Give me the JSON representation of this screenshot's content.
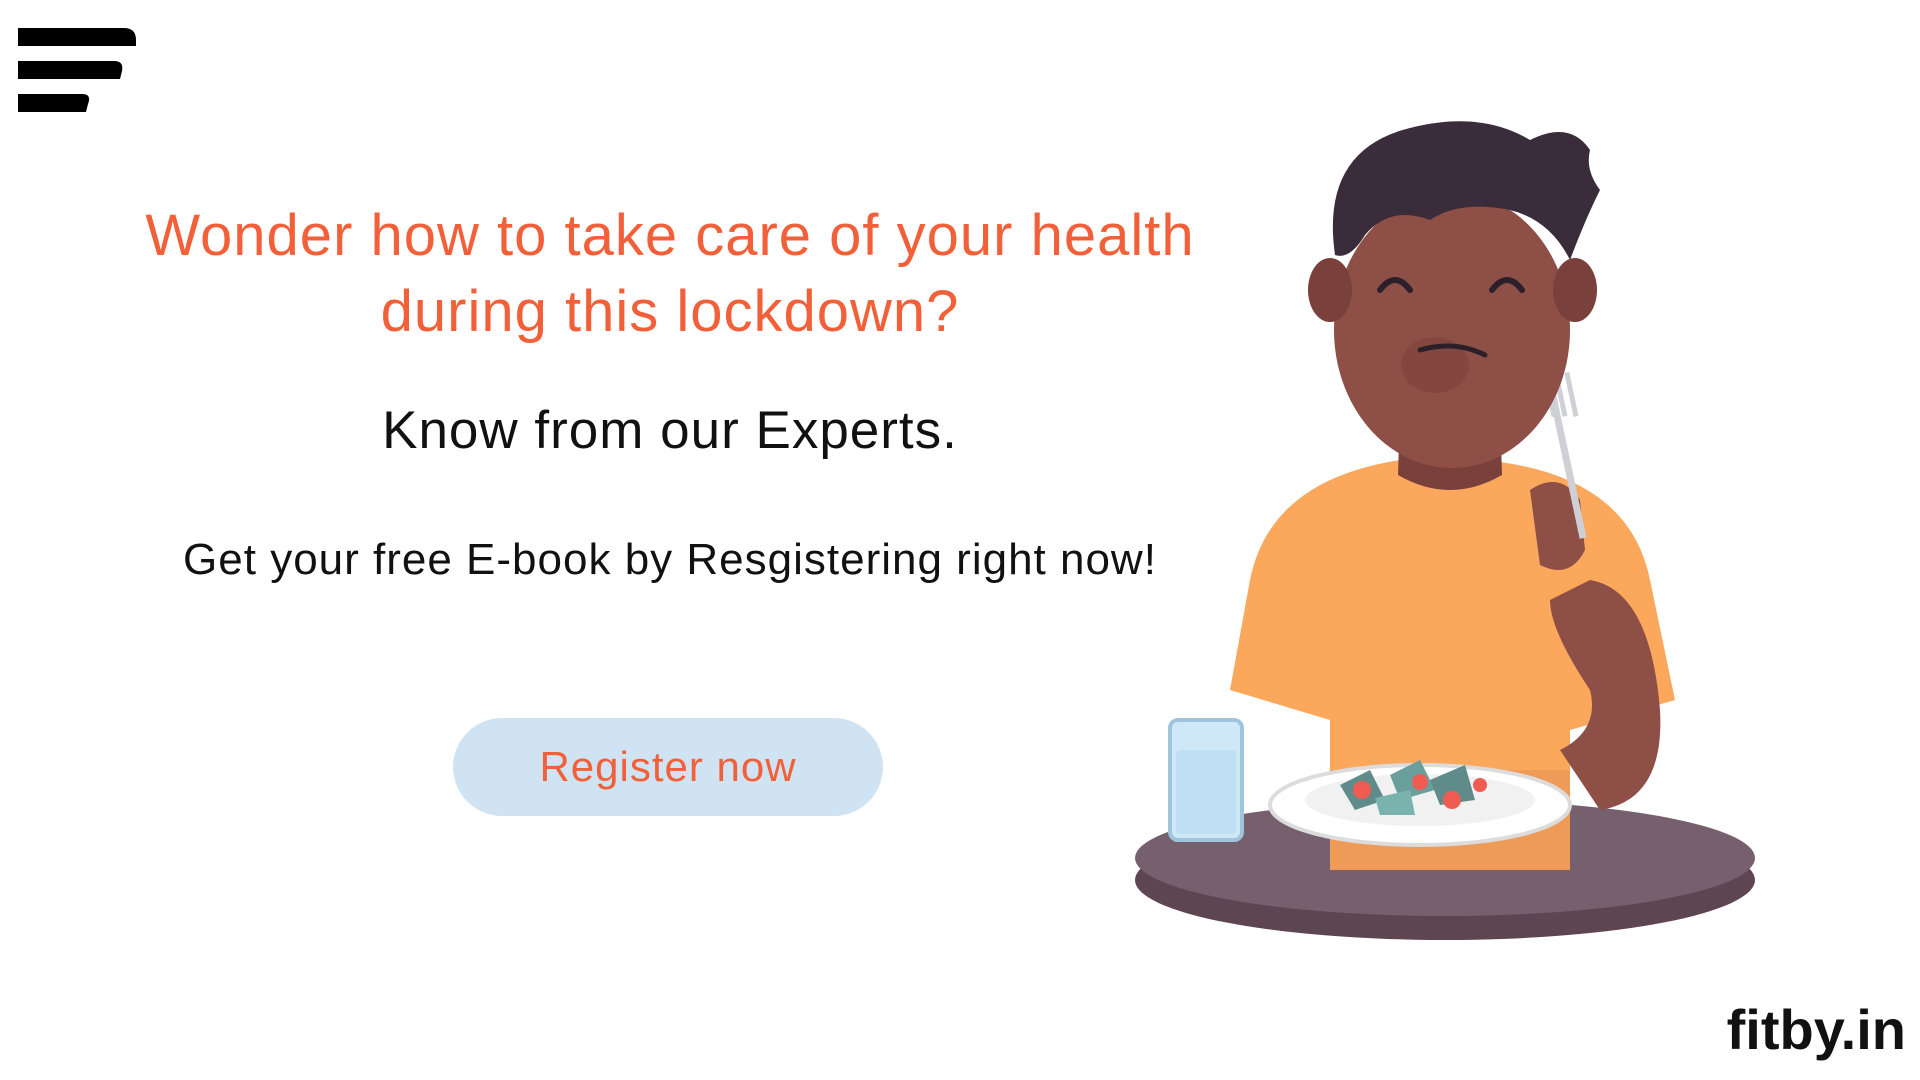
{
  "headline": "Wonder how to take care of your  health\nduring this lockdown?",
  "subhead": "Know from our Experts.",
  "cta_text": "Get your free E-book by Resgistering right now!",
  "register_button": {
    "label": "Register now"
  },
  "brand": "fitby.in",
  "logo": {
    "icon": "menu-bars-logo-icon"
  },
  "illustration": {
    "icon": "man-eating-salad-illustration"
  },
  "colors": {
    "accent": "#f2603a",
    "button_bg": "#cfe3f2",
    "text": "#111111",
    "shirt": "#fba75c",
    "skin": "#8e4f46",
    "hair": "#3a2c3a",
    "table": "#6b5563"
  }
}
